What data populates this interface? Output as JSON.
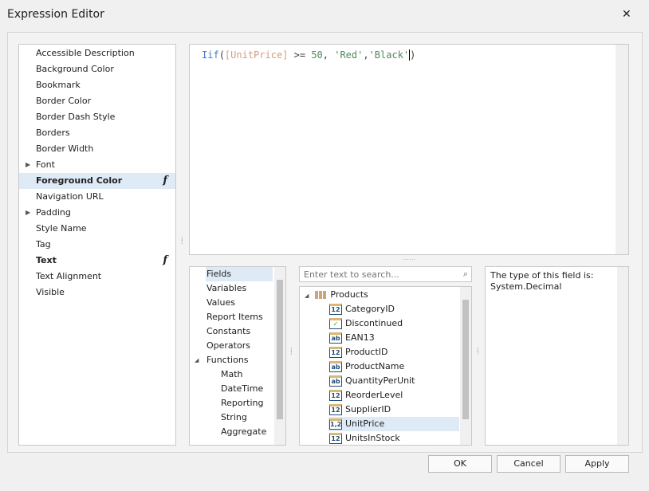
{
  "window": {
    "title": "Expression Editor",
    "close": "✕"
  },
  "properties": [
    {
      "label": "Accessible Description"
    },
    {
      "label": "Background Color"
    },
    {
      "label": "Bookmark"
    },
    {
      "label": "Border Color"
    },
    {
      "label": "Border Dash Style"
    },
    {
      "label": "Borders"
    },
    {
      "label": "Border Width"
    },
    {
      "label": "Font",
      "expandable": true
    },
    {
      "label": "Foreground Color",
      "bold": true,
      "selected": true,
      "has_expression": true
    },
    {
      "label": "Navigation URL"
    },
    {
      "label": "Padding",
      "expandable": true
    },
    {
      "label": "Style Name"
    },
    {
      "label": "Tag"
    },
    {
      "label": "Text",
      "bold": true,
      "has_expression": true
    },
    {
      "label": "Text Alignment"
    },
    {
      "label": "Visible"
    }
  ],
  "expression": {
    "func": "Iif",
    "open": "(",
    "field": "[UnitPrice]",
    "op": " >= ",
    "num": "50",
    "sep1": ", ",
    "s1": "'Red'",
    "sep2": ",",
    "s2": "'Black'",
    "close": ")",
    "colors": {
      "func": "#3b7fc4",
      "field": "#d69b7c",
      "num": "#4e8a5c",
      "string": "#4e8a5c",
      "plain": "#404040"
    }
  },
  "fx_glyph": "f",
  "categories": [
    {
      "label": "Fields",
      "selected": true
    },
    {
      "label": "Variables"
    },
    {
      "label": "Values"
    },
    {
      "label": "Report Items"
    },
    {
      "label": "Constants"
    },
    {
      "label": "Operators"
    },
    {
      "label": "Functions",
      "expanded": true
    },
    {
      "label": "Math",
      "child": true
    },
    {
      "label": "DateTime",
      "child": true
    },
    {
      "label": "Reporting",
      "child": true
    },
    {
      "label": "String",
      "child": true
    },
    {
      "label": "Aggregate",
      "child": true
    }
  ],
  "search": {
    "placeholder": "Enter text to search..."
  },
  "tree": {
    "root": "Products",
    "fields": [
      {
        "label": "CategoryID",
        "type": "12"
      },
      {
        "label": "Discontinued",
        "type": "✓"
      },
      {
        "label": "EAN13",
        "type": "ab"
      },
      {
        "label": "ProductID",
        "type": "12"
      },
      {
        "label": "ProductName",
        "type": "ab"
      },
      {
        "label": "QuantityPerUnit",
        "type": "ab"
      },
      {
        "label": "ReorderLevel",
        "type": "12"
      },
      {
        "label": "SupplierID",
        "type": "12"
      },
      {
        "label": "UnitPrice",
        "type": "1,2",
        "selected": true
      },
      {
        "label": "UnitsInStock",
        "type": "12"
      }
    ]
  },
  "description": "The type of this field is: System.Decimal",
  "buttons": {
    "ok": "OK",
    "cancel": "Cancel",
    "apply": "Apply"
  }
}
